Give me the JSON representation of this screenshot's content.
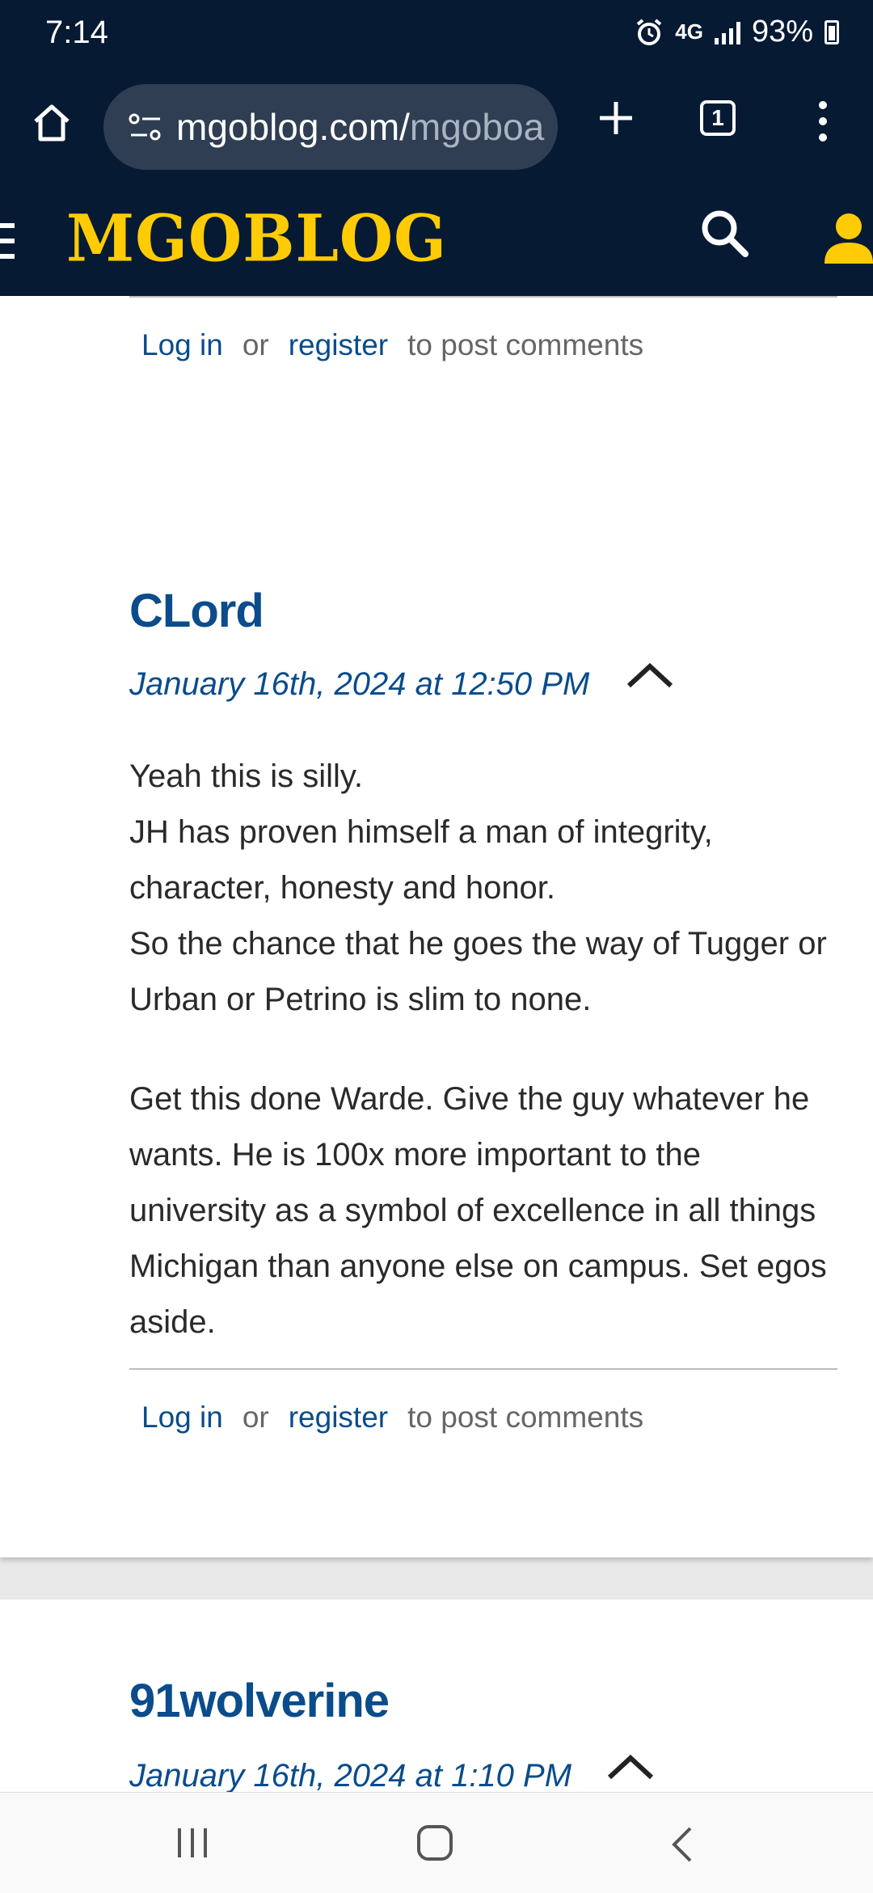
{
  "status_bar": {
    "time": "7:14",
    "network": "4G",
    "battery": "93%"
  },
  "browser": {
    "url_main": "mgoblog.com/",
    "url_dim": "mgoboa",
    "tab_count": "1"
  },
  "site": {
    "logo": "MGOBLOG"
  },
  "comments": [
    {
      "links": {
        "login": "Log in",
        "or": "or",
        "register": "register",
        "suffix": "to post comments"
      }
    },
    {
      "author": "CLord",
      "date": "January 16th, 2024 at 12:50 PM",
      "paragraph1": [
        "Yeah this is silly.",
        "JH has proven himself a man of integrity, character, honesty and honor.",
        "So the chance that he goes the way of Tugger or Urban or Petrino is slim to none."
      ],
      "paragraph2": "Get this done Warde.  Give the guy whatever he wants. He is 100x more important to the university as a symbol of excellence in all things Michigan than anyone else on campus.  Set egos aside.",
      "links": {
        "login": "Log in",
        "or": "or",
        "register": "register",
        "suffix": "to post comments"
      }
    },
    {
      "author": "91wolverine",
      "date": "January 16th, 2024 at 1:10 PM"
    }
  ]
}
